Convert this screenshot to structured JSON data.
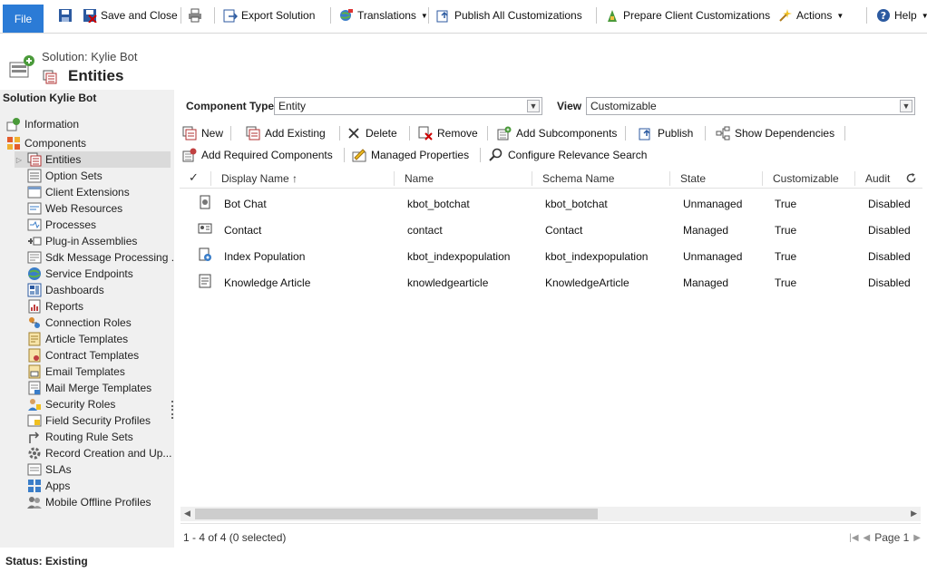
{
  "ribbon": {
    "file_label": "File",
    "save_and_close": "Save and Close",
    "export_solution": "Export Solution",
    "translations": "Translations",
    "publish_all": "Publish All Customizations",
    "prepare_client": "Prepare Client Customizations",
    "actions": "Actions",
    "help": "Help"
  },
  "header": {
    "solution": "Solution: Kylie Bot",
    "title": "Entities"
  },
  "sidebar": {
    "title": "Solution Kylie Bot",
    "information": "Information",
    "components": "Components",
    "items": [
      {
        "label": "Entities",
        "icon": "entities-icon"
      },
      {
        "label": "Option Sets",
        "icon": "option-sets-icon"
      },
      {
        "label": "Client Extensions",
        "icon": "client-extensions-icon"
      },
      {
        "label": "Web Resources",
        "icon": "web-resources-icon"
      },
      {
        "label": "Processes",
        "icon": "processes-icon"
      },
      {
        "label": "Plug-in Assemblies",
        "icon": "plugin-assemblies-icon"
      },
      {
        "label": "Sdk Message Processing ...",
        "icon": "sdk-message-icon"
      },
      {
        "label": "Service Endpoints",
        "icon": "globe-icon"
      },
      {
        "label": "Dashboards",
        "icon": "dashboards-icon"
      },
      {
        "label": "Reports",
        "icon": "reports-icon"
      },
      {
        "label": "Connection Roles",
        "icon": "connection-roles-icon"
      },
      {
        "label": "Article Templates",
        "icon": "article-templates-icon"
      },
      {
        "label": "Contract Templates",
        "icon": "contract-templates-icon"
      },
      {
        "label": "Email Templates",
        "icon": "email-templates-icon"
      },
      {
        "label": "Mail Merge Templates",
        "icon": "mail-merge-icon"
      },
      {
        "label": "Security Roles",
        "icon": "security-roles-icon"
      },
      {
        "label": "Field Security Profiles",
        "icon": "field-security-icon"
      },
      {
        "label": "Routing Rule Sets",
        "icon": "routing-icon"
      },
      {
        "label": "Record Creation and Up...",
        "icon": "gear-icon"
      },
      {
        "label": "SLAs",
        "icon": "sla-icon"
      },
      {
        "label": "Apps",
        "icon": "apps-icon"
      },
      {
        "label": "Mobile Offline Profiles",
        "icon": "mobile-offline-icon"
      }
    ]
  },
  "filters": {
    "component_type_label": "Component Type",
    "component_type_value": "Entity",
    "view_label": "View",
    "view_value": "Customizable"
  },
  "toolbar": {
    "new": "New",
    "add_existing": "Add Existing",
    "delete": "Delete",
    "remove": "Remove",
    "add_subcomponents": "Add Subcomponents",
    "publish": "Publish",
    "show_dependencies": "Show Dependencies",
    "add_required": "Add Required Components",
    "managed_properties": "Managed Properties",
    "configure_relevance": "Configure Relevance Search"
  },
  "grid": {
    "headers": {
      "display_name": "Display Name ↑",
      "name": "Name",
      "schema_name": "Schema Name",
      "state": "State",
      "customizable": "Customizable",
      "audit": "Audit"
    },
    "rows": [
      {
        "display_name": "Bot Chat",
        "name": "kbot_botchat",
        "schema_name": "kbot_botchat",
        "state": "Unmanaged",
        "customizable": "True",
        "audit": "Disabled",
        "icon": "bot-chat-icon"
      },
      {
        "display_name": "Contact",
        "name": "contact",
        "schema_name": "Contact",
        "state": "Managed",
        "customizable": "True",
        "audit": "Disabled",
        "icon": "contact-icon"
      },
      {
        "display_name": "Index Population",
        "name": "kbot_indexpopulation",
        "schema_name": "kbot_indexpopulation",
        "state": "Unmanaged",
        "customizable": "True",
        "audit": "Disabled",
        "icon": "index-population-icon"
      },
      {
        "display_name": "Knowledge Article",
        "name": "knowledgearticle",
        "schema_name": "KnowledgeArticle",
        "state": "Managed",
        "customizable": "True",
        "audit": "Disabled",
        "icon": "knowledge-article-icon"
      }
    ],
    "record_count": "1 - 4 of 4 (0 selected)",
    "page_label": "Page 1"
  },
  "status": {
    "text": "Status: Existing"
  },
  "colors": {
    "file_blue": "#2b7bd6",
    "sidebar_bg": "#f0f0f0",
    "selected_bg": "#dadada"
  }
}
